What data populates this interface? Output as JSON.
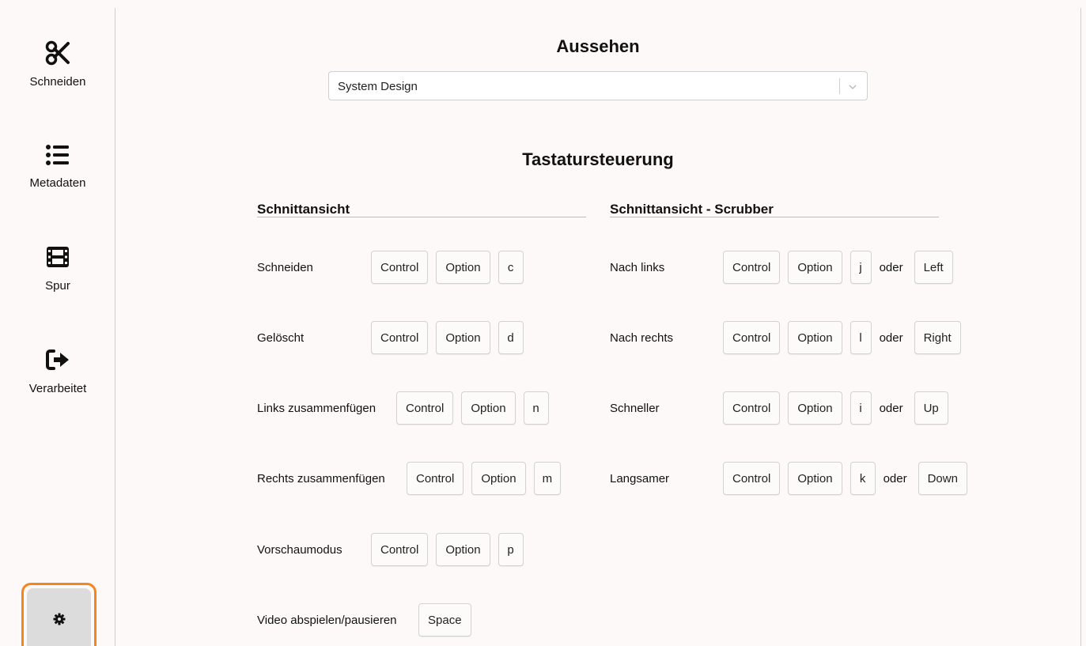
{
  "sidebar": {
    "items": [
      {
        "label": "Schneiden",
        "icon": "scissors-icon"
      },
      {
        "label": "Metadaten",
        "icon": "list-icon"
      },
      {
        "label": "Spur",
        "icon": "film-icon"
      },
      {
        "label": "Verarbeitet",
        "icon": "sign-out-icon"
      }
    ],
    "settings_icon": "gear-icon",
    "active_outline_color": "#f4861f"
  },
  "appearance": {
    "title": "Aussehen",
    "select_value": "System Design"
  },
  "keyboard": {
    "title": "Tastatursteuerung",
    "or_label": "oder",
    "left": {
      "title": "Schnittansicht",
      "rows": [
        {
          "name": "Schneiden",
          "keys": [
            "Control",
            "Option",
            "c"
          ]
        },
        {
          "name": "Gelöscht",
          "keys": [
            "Control",
            "Option",
            "d"
          ]
        },
        {
          "name": "Links zusammenfügen",
          "keys": [
            "Control",
            "Option",
            "n"
          ]
        },
        {
          "name": "Rechts zusammenfügen",
          "keys": [
            "Control",
            "Option",
            "m"
          ]
        },
        {
          "name": "Vorschaumodus",
          "keys": [
            "Control",
            "Option",
            "p"
          ]
        },
        {
          "name": "Video abspielen/pausieren",
          "keys": [
            "Space"
          ]
        }
      ]
    },
    "right": {
      "title": "Schnittansicht - Scrubber",
      "rows": [
        {
          "name": "Nach links",
          "keys": [
            "Control",
            "Option",
            "j"
          ],
          "alt": "Left"
        },
        {
          "name": "Nach rechts",
          "keys": [
            "Control",
            "Option",
            "l"
          ],
          "alt": "Right"
        },
        {
          "name": "Schneller",
          "keys": [
            "Control",
            "Option",
            "i"
          ],
          "alt": "Up"
        },
        {
          "name": "Langsamer",
          "keys": [
            "Control",
            "Option",
            "k"
          ],
          "alt": "Down"
        }
      ]
    }
  }
}
